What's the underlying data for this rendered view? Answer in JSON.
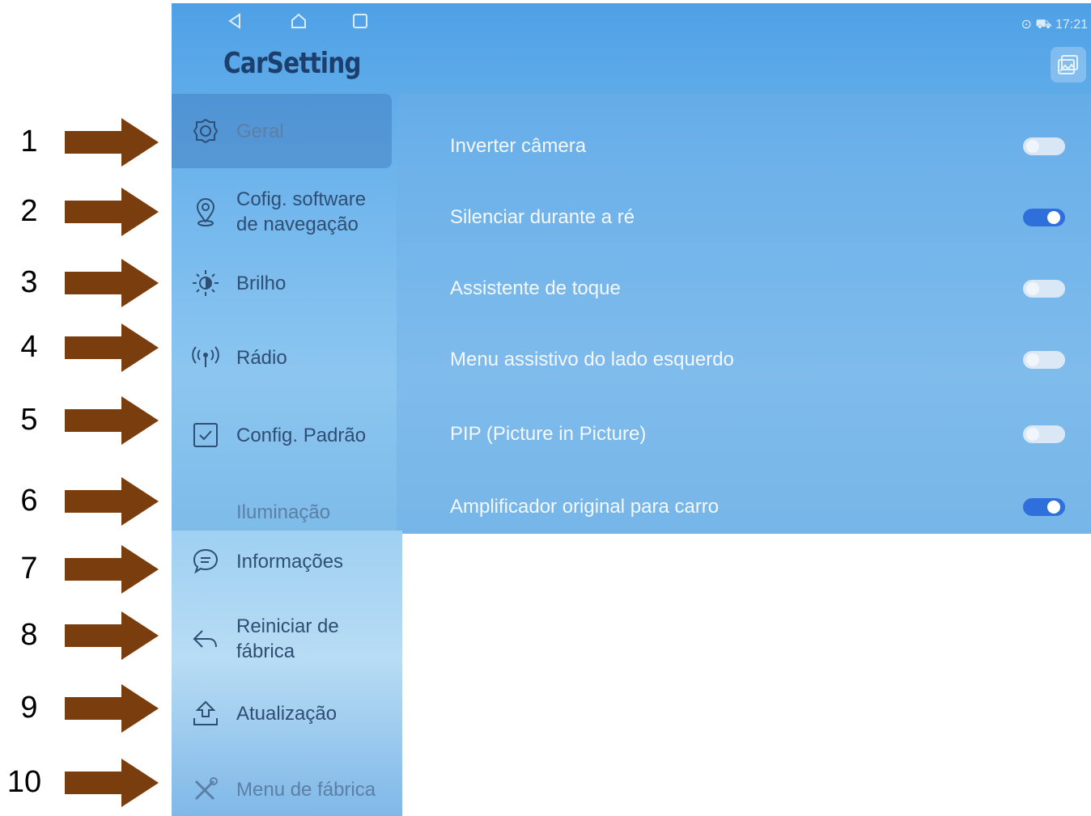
{
  "annotations": [
    "1",
    "2",
    "3",
    "4",
    "5",
    "6",
    "7",
    "8",
    "9",
    "10"
  ],
  "annotation_color": "#7a3d0e",
  "status": {
    "time": "17:21"
  },
  "app": {
    "title": "CarSetting"
  },
  "sidebar": {
    "items": [
      {
        "label": "Geral",
        "icon": "gear-icon",
        "selected": true
      },
      {
        "label_line1": "Cofig. software",
        "label_line2": "de navegação",
        "icon": "location-pin-icon"
      },
      {
        "label": "Brilho",
        "icon": "brightness-icon"
      },
      {
        "label": "Rádio",
        "icon": "radio-antenna-icon"
      },
      {
        "label": "Config. Padrão",
        "icon": "checkbox-icon"
      },
      {
        "label": "Iluminação",
        "icon": ""
      },
      {
        "label": "Informações",
        "icon": "chat-bubble-icon"
      },
      {
        "label_line1": "Reiniciar de",
        "label_line2": "fábrica",
        "icon": "reset-arrow-icon"
      },
      {
        "label": "Atualização",
        "icon": "upload-icon"
      },
      {
        "label": "Menu de fábrica",
        "icon": "tools-icon"
      }
    ]
  },
  "settings": [
    {
      "label": "Inverter câmera",
      "on": false
    },
    {
      "label": "Silenciar durante a ré",
      "on": true
    },
    {
      "label": "Assistente de toque",
      "on": false
    },
    {
      "label": "Menu assistivo do lado esquerdo",
      "on": false
    },
    {
      "label": "PIP (Picture in Picture)",
      "on": false
    },
    {
      "label": "Amplificador original para carro",
      "on": true
    }
  ],
  "colors": {
    "accent": "#2f6fdc",
    "title": "#1c3f6e"
  }
}
